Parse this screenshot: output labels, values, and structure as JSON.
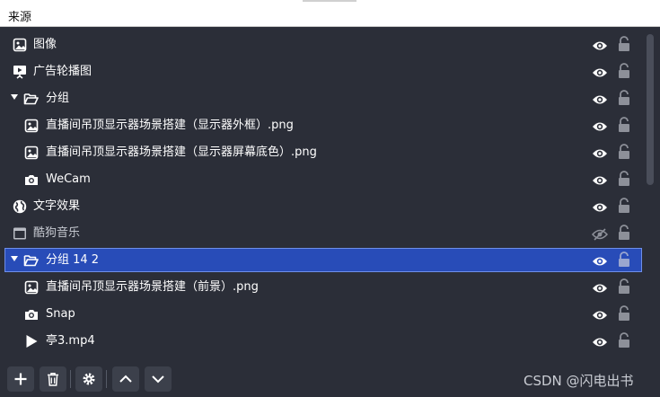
{
  "panel": {
    "title": "来源"
  },
  "sources": [
    {
      "label": "图像",
      "icon": "image-icon",
      "visible": true,
      "locked": false,
      "selected": false
    },
    {
      "label": "广告轮播图",
      "icon": "slideshow-icon",
      "visible": true,
      "locked": false,
      "selected": false
    },
    {
      "label": "分组",
      "icon": "folder-open-icon",
      "visible": true,
      "locked": false,
      "selected": false,
      "expanded": true
    },
    {
      "label": "直播间吊顶显示器场景搭建（显示器外框）.png",
      "icon": "image-icon",
      "visible": true,
      "locked": false,
      "selected": false
    },
    {
      "label": "直播间吊顶显示器场景搭建（显示器屏幕底色）.png",
      "icon": "image-icon",
      "visible": true,
      "locked": false,
      "selected": false
    },
    {
      "label": "WeCam",
      "icon": "camera-icon",
      "visible": true,
      "locked": false,
      "selected": false
    },
    {
      "label": "文字效果",
      "icon": "globe-icon",
      "visible": true,
      "locked": false,
      "selected": false
    },
    {
      "label": "酷狗音乐",
      "icon": "window-icon",
      "visible": false,
      "locked": false,
      "selected": false
    },
    {
      "label": "分组 14 2",
      "icon": "folder-open-icon",
      "visible": true,
      "locked": false,
      "selected": true,
      "expanded": true
    },
    {
      "label": "直播间吊顶显示器场景搭建（前景）.png",
      "icon": "image-icon",
      "visible": true,
      "locked": false,
      "selected": false
    },
    {
      "label": "Snap",
      "icon": "camera-icon",
      "visible": true,
      "locked": false,
      "selected": false
    },
    {
      "label": "亭3.mp4",
      "icon": "play-icon",
      "visible": true,
      "locked": false,
      "selected": false
    }
  ],
  "toolbar": {
    "add_icon": "plus-icon",
    "remove_icon": "trash-icon",
    "properties_icon": "gear-icon",
    "move_up_icon": "chevron-up-icon",
    "move_down_icon": "chevron-down-icon"
  },
  "watermark": "CSDN @闪电出书"
}
